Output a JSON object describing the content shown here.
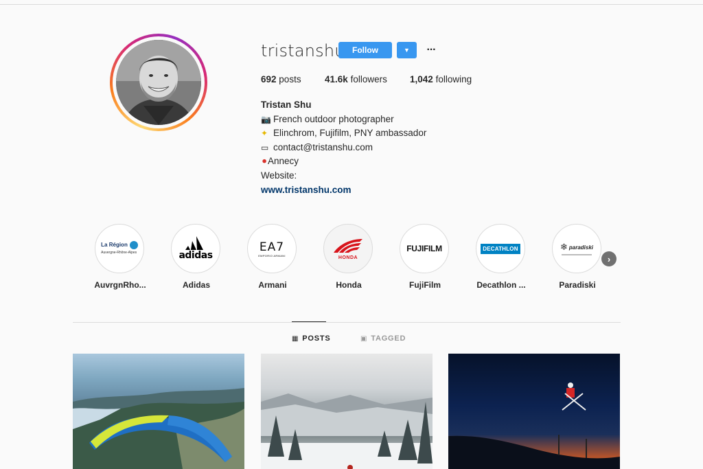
{
  "profile": {
    "username": "tristanshu",
    "follow_label": "Follow",
    "more_label": "···",
    "stats": {
      "posts_count": "692",
      "posts_label": "posts",
      "followers_count": "41.6k",
      "followers_label": "followers",
      "following_count": "1,042",
      "following_label": "following"
    },
    "bio": {
      "name": "Tristan Shu",
      "line1_icon": "camera-icon",
      "line1": "French outdoor photographer",
      "line2_icon": "sparkle-icon",
      "line2": "Elinchrom, Fujifilm, PNY ambassador",
      "line3_icon": "envelope-icon",
      "line3": "contact@tristanshu.com",
      "line4_icon": "pin-icon",
      "line4": "Annecy",
      "line5": "Website:",
      "website": "www.tristanshu.com"
    }
  },
  "highlights": [
    {
      "label": "AuvrgnRho...",
      "logo_line1": "La Région",
      "logo_line2": "Auvergne-Rhône-Alpes"
    },
    {
      "label": "Adidas",
      "logo": "adidas"
    },
    {
      "label": "Armani",
      "logo": "EA7",
      "logo_sub": "EMPORIO ARMANI"
    },
    {
      "label": "Honda",
      "logo": "HONDA"
    },
    {
      "label": "FujiFilm",
      "logo": "FUJIFILM"
    },
    {
      "label": "Decathlon ...",
      "logo": "DECATHLON"
    },
    {
      "label": "Paradiski",
      "logo": "paradiski"
    }
  ],
  "tabs": {
    "posts": "POSTS",
    "tagged": "TAGGED"
  },
  "colors": {
    "accent": "#3897f0",
    "link": "#003569",
    "text": "#262626",
    "muted": "#999999",
    "background": "#fafafa"
  }
}
